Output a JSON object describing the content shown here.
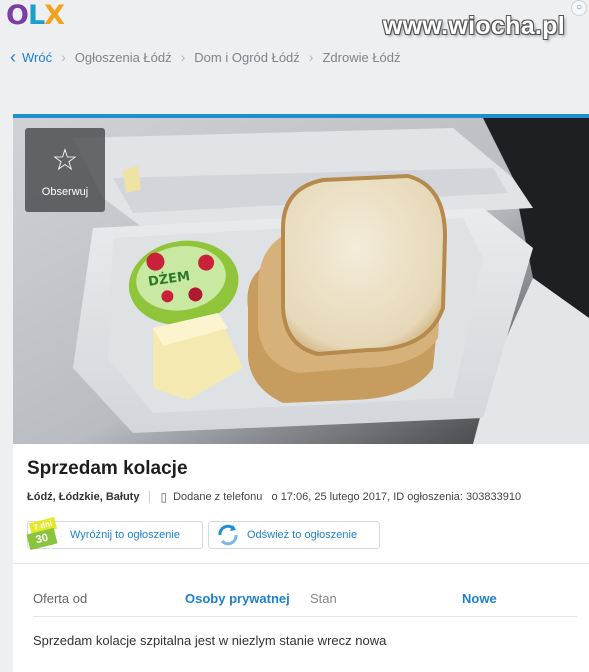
{
  "logo": {
    "part1": "O",
    "part2": "L",
    "part3": "X"
  },
  "watermark": "www.wiocha.pl",
  "breadcrumb": {
    "back_label": "Wróć",
    "items": [
      "Ogłoszenia Łódź",
      "Dom i Ogród Łódź",
      "Zdrowie Łódź"
    ]
  },
  "listing": {
    "observe_label": "Obserwuj",
    "title": "Sprzedam kolacje",
    "location": "Łódź, Łódzkie, Bałuty",
    "added_info": "Dodane z telefonu   o 17:06, 25 lutego 2017, ID ogłoszenia: 303833910",
    "promote_button": "Wyróżnij to ogłoszenie",
    "refresh_button": "Odśwież to ogłoszenie",
    "badge_top": "7 dni",
    "badge_bottom": "30 dni",
    "params": [
      {
        "key": "Oferta od",
        "value": "Osoby prywatnej"
      },
      {
        "key": "Stan",
        "value": "Nowe"
      }
    ],
    "description": "Sprzedam kolacje szpitalna jest w niezlym stanie wrecz nowa",
    "jam_label": "DŻEM"
  },
  "colors": {
    "accent": "#1f7fcf",
    "card_border": "#1f8fd3",
    "olx_purple": "#7b3fa3",
    "olx_cyan": "#1da0c8",
    "olx_orange": "#f2a21d"
  },
  "icons": [
    "chevron-left-icon",
    "star-icon",
    "phone-icon",
    "refresh-icon",
    "user-icon"
  ]
}
